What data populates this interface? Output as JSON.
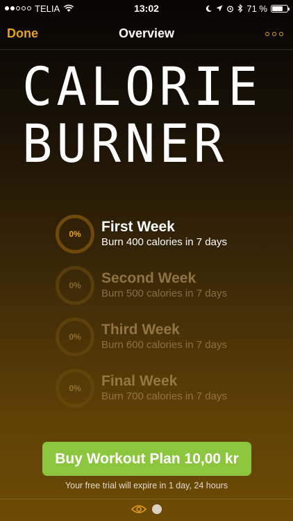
{
  "status_bar": {
    "carrier": "TELIA",
    "time": "13:02",
    "battery_percent": "71 %",
    "signal_bars_filled": 2,
    "signal_bars_total": 5,
    "battery_fill_fraction": 0.71
  },
  "nav": {
    "done_label": "Done",
    "title": "Overview",
    "more_icon": "ellipsis-icon"
  },
  "hero": {
    "line1": "CALORIE",
    "line2": "BURNER"
  },
  "weeks": [
    {
      "progress": "0%",
      "title": "First Week",
      "description": "Burn 400 calories in 7 days",
      "state": "active"
    },
    {
      "progress": "0%",
      "title": "Second Week",
      "description": "Burn 500 calories in 7 days",
      "state": "locked"
    },
    {
      "progress": "0%",
      "title": "Third Week",
      "description": "Burn 600 calories in 7 days",
      "state": "locked"
    },
    {
      "progress": "0%",
      "title": "Final Week",
      "description": "Burn 700 calories in 7 days",
      "state": "locked"
    }
  ],
  "buy_button_label": "Buy Workout Plan 10,00 kr",
  "trial_text": "Your free trial will expire in 1 day, 24 hours",
  "page_indicator": {
    "pages": 2,
    "current": 2
  },
  "colors": {
    "accent": "#e8a31c",
    "buy_button": "#8cc63e"
  }
}
